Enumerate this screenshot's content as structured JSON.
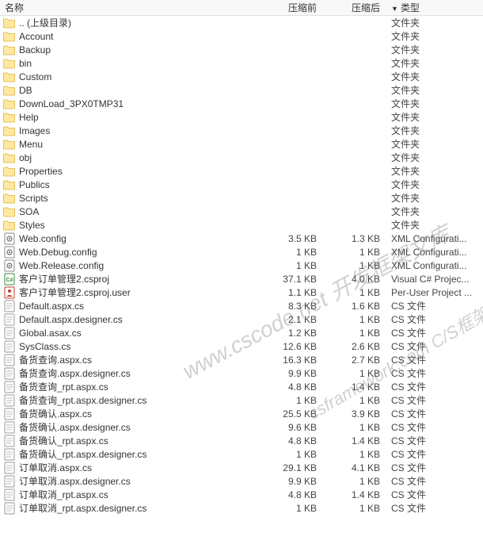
{
  "header": {
    "name": "名称",
    "size_before": "压缩前",
    "size_after": "压缩后",
    "type": "类型",
    "sort_indicator": "▼"
  },
  "watermarks": {
    "w1": "www.cscode.net 开发框架文库",
    "w2": "csframework.com C/S框架文库"
  },
  "rows": [
    {
      "icon": "folder",
      "name": ".. (上级目录)",
      "before": "",
      "after": "",
      "type": "文件夹"
    },
    {
      "icon": "folder",
      "name": "Account",
      "before": "",
      "after": "",
      "type": "文件夹"
    },
    {
      "icon": "folder",
      "name": "Backup",
      "before": "",
      "after": "",
      "type": "文件夹"
    },
    {
      "icon": "folder",
      "name": "bin",
      "before": "",
      "after": "",
      "type": "文件夹"
    },
    {
      "icon": "folder",
      "name": "Custom",
      "before": "",
      "after": "",
      "type": "文件夹"
    },
    {
      "icon": "folder",
      "name": "DB",
      "before": "",
      "after": "",
      "type": "文件夹"
    },
    {
      "icon": "folder",
      "name": "DownLoad_3PX0TMP31",
      "before": "",
      "after": "",
      "type": "文件夹"
    },
    {
      "icon": "folder",
      "name": "Help",
      "before": "",
      "after": "",
      "type": "文件夹"
    },
    {
      "icon": "folder",
      "name": "Images",
      "before": "",
      "after": "",
      "type": "文件夹"
    },
    {
      "icon": "folder",
      "name": "Menu",
      "before": "",
      "after": "",
      "type": "文件夹"
    },
    {
      "icon": "folder",
      "name": "obj",
      "before": "",
      "after": "",
      "type": "文件夹"
    },
    {
      "icon": "folder",
      "name": "Properties",
      "before": "",
      "after": "",
      "type": "文件夹"
    },
    {
      "icon": "folder",
      "name": "Publics",
      "before": "",
      "after": "",
      "type": "文件夹"
    },
    {
      "icon": "folder",
      "name": "Scripts",
      "before": "",
      "after": "",
      "type": "文件夹"
    },
    {
      "icon": "folder",
      "name": "SOA",
      "before": "",
      "after": "",
      "type": "文件夹"
    },
    {
      "icon": "folder",
      "name": "Styles",
      "before": "",
      "after": "",
      "type": "文件夹"
    },
    {
      "icon": "config",
      "name": "Web.config",
      "before": "3.5 KB",
      "after": "1.3 KB",
      "type": "XML Configurati..."
    },
    {
      "icon": "config",
      "name": "Web.Debug.config",
      "before": "1 KB",
      "after": "1 KB",
      "type": "XML Configurati..."
    },
    {
      "icon": "config",
      "name": "Web.Release.config",
      "before": "1 KB",
      "after": "1 KB",
      "type": "XML Configurati..."
    },
    {
      "icon": "csproj",
      "name": "客户订单管理2.csproj",
      "before": "37.1 KB",
      "after": "4.0 KB",
      "type": "Visual C# Projec..."
    },
    {
      "icon": "user",
      "name": "客户订单管理2.csproj.user",
      "before": "1.1 KB",
      "after": "1 KB",
      "type": "Per-User Project ..."
    },
    {
      "icon": "cs",
      "name": "Default.aspx.cs",
      "before": "8.3 KB",
      "after": "1.6 KB",
      "type": "CS 文件"
    },
    {
      "icon": "cs",
      "name": "Default.aspx.designer.cs",
      "before": "2.1 KB",
      "after": "1 KB",
      "type": "CS 文件"
    },
    {
      "icon": "cs",
      "name": "Global.asax.cs",
      "before": "1.2 KB",
      "after": "1 KB",
      "type": "CS 文件"
    },
    {
      "icon": "cs",
      "name": "SysClass.cs",
      "before": "12.6 KB",
      "after": "2.6 KB",
      "type": "CS 文件"
    },
    {
      "icon": "cs",
      "name": "备货查询.aspx.cs",
      "before": "16.3 KB",
      "after": "2.7 KB",
      "type": "CS 文件"
    },
    {
      "icon": "cs",
      "name": "备货查询.aspx.designer.cs",
      "before": "9.9 KB",
      "after": "1 KB",
      "type": "CS 文件"
    },
    {
      "icon": "cs",
      "name": "备货查询_rpt.aspx.cs",
      "before": "4.8 KB",
      "after": "1.4 KB",
      "type": "CS 文件"
    },
    {
      "icon": "cs",
      "name": "备货查询_rpt.aspx.designer.cs",
      "before": "1 KB",
      "after": "1 KB",
      "type": "CS 文件"
    },
    {
      "icon": "cs",
      "name": "备货确认.aspx.cs",
      "before": "25.5 KB",
      "after": "3.9 KB",
      "type": "CS 文件"
    },
    {
      "icon": "cs",
      "name": "备货确认.aspx.designer.cs",
      "before": "9.6 KB",
      "after": "1 KB",
      "type": "CS 文件"
    },
    {
      "icon": "cs",
      "name": "备货确认_rpt.aspx.cs",
      "before": "4.8 KB",
      "after": "1.4 KB",
      "type": "CS 文件"
    },
    {
      "icon": "cs",
      "name": "备货确认_rpt.aspx.designer.cs",
      "before": "1 KB",
      "after": "1 KB",
      "type": "CS 文件"
    },
    {
      "icon": "cs",
      "name": "订单取消.aspx.cs",
      "before": "29.1 KB",
      "after": "4.1 KB",
      "type": "CS 文件"
    },
    {
      "icon": "cs",
      "name": "订单取消.aspx.designer.cs",
      "before": "9.9 KB",
      "after": "1 KB",
      "type": "CS 文件"
    },
    {
      "icon": "cs",
      "name": "订单取消_rpt.aspx.cs",
      "before": "4.8 KB",
      "after": "1.4 KB",
      "type": "CS 文件"
    },
    {
      "icon": "cs",
      "name": "订单取消_rpt.aspx.designer.cs",
      "before": "1 KB",
      "after": "1 KB",
      "type": "CS 文件"
    }
  ]
}
